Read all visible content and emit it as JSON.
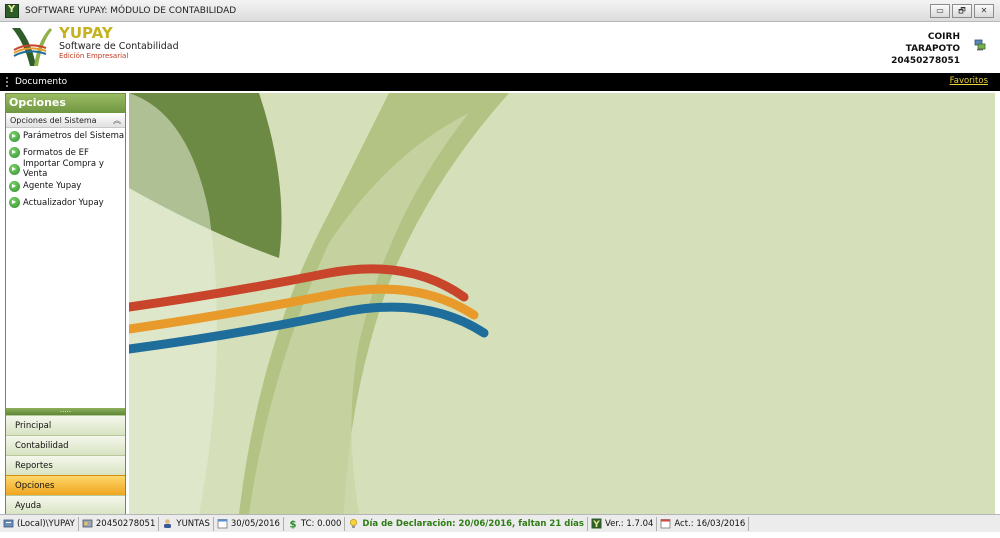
{
  "window": {
    "title": "SOFTWARE YUPAY: MÓDULO DE CONTABILIDAD",
    "minimize": "▭",
    "restore": "🗗",
    "close": "✕"
  },
  "header": {
    "brand_name": "YUPAY",
    "brand_sub": "Software de Contabilidad",
    "brand_edition": "Edición Empresarial",
    "company_name": "COIRH",
    "company_city": "TARAPOTO",
    "company_ruc": "20450278051",
    "net_icon": "network-computer-icon"
  },
  "menubar": {
    "documento": "Documento",
    "favoritos": "Favoritos"
  },
  "sidebar": {
    "title": "Opciones",
    "group": "Opciones del Sistema",
    "items": [
      {
        "label": "Parámetros del Sistema"
      },
      {
        "label": "Formatos de EF"
      },
      {
        "label": "Importar Compra y Venta"
      },
      {
        "label": "Agente Yupay"
      },
      {
        "label": "Actualizador Yupay"
      }
    ],
    "splitter": ".....",
    "nav": [
      {
        "label": "Principal",
        "active": false
      },
      {
        "label": "Contabilidad",
        "active": false
      },
      {
        "label": "Reportes",
        "active": false
      },
      {
        "label": "Opciones",
        "active": true
      },
      {
        "label": "Ayuda",
        "active": false
      }
    ]
  },
  "status": {
    "server": "(Local)\\YUPAY",
    "ruc": "20450278051",
    "user": "YUNTAS",
    "date": "30/05/2016",
    "tc": "TC: 0.000",
    "declaration": "Día de Declaración: 20/06/2016, faltan 21 días",
    "version": "Ver.: 1.7.04",
    "updated": "Act.: 16/03/2016"
  },
  "colors": {
    "accent_green": "#6f9640",
    "active_orange": "#f0a520",
    "canvas_bg": "#d5e0bb",
    "ribbon_red": "#c8442a",
    "ribbon_orange": "#e89a2a",
    "ribbon_blue": "#1f6d9b"
  }
}
